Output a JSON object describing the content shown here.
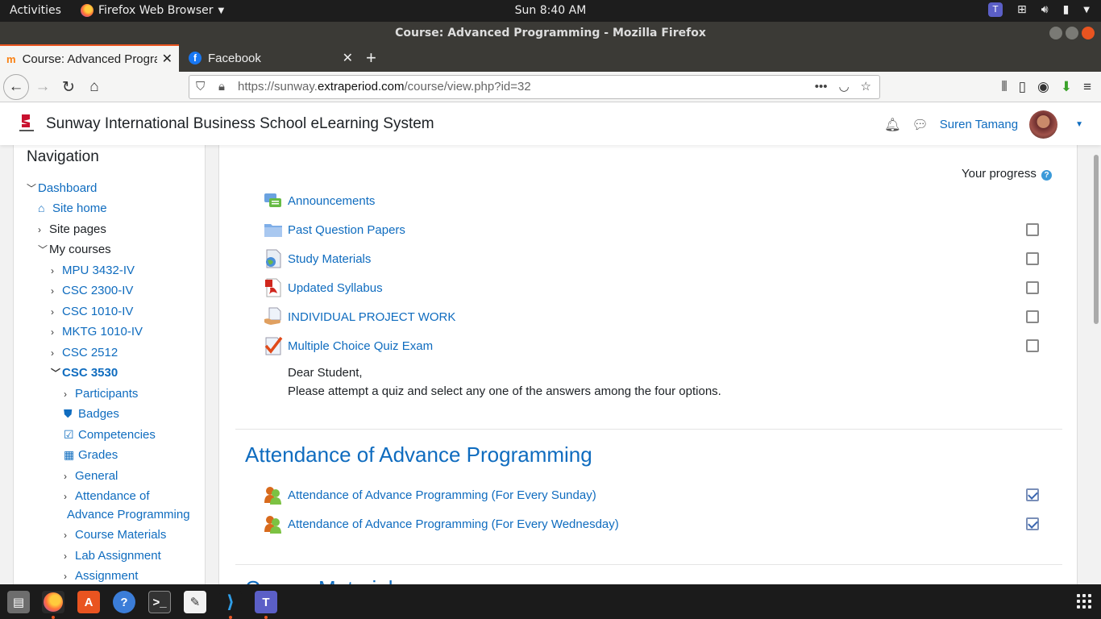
{
  "topbar": {
    "activities": "Activities",
    "app_name": "Firefox Web Browser",
    "clock": "Sun  8:40 AM"
  },
  "window": {
    "title": "Course: Advanced Programming - Mozilla Firefox"
  },
  "tabs": [
    {
      "label": "Course: Advanced Programming",
      "active": true
    },
    {
      "label": "Facebook",
      "active": false
    }
  ],
  "urlbar": {
    "prefix": "https://sunway.",
    "domain": "extraperiod.com",
    "path": "/course/view.php?id=32"
  },
  "header": {
    "site_name": "Sunway International Business School eLearning System",
    "user_name": "Suren Tamang"
  },
  "navigation": {
    "title": "Navigation",
    "items": [
      {
        "label": "Dashboard"
      },
      {
        "label": "Site home"
      },
      {
        "label": "Site pages"
      },
      {
        "label": "My courses"
      },
      {
        "label": "MPU 3432-IV"
      },
      {
        "label": "CSC 2300-IV"
      },
      {
        "label": "CSC 1010-IV"
      },
      {
        "label": "MKTG 1010-IV"
      },
      {
        "label": "CSC 2512"
      },
      {
        "label": "CSC 3530"
      },
      {
        "label": "Participants"
      },
      {
        "label": "Badges"
      },
      {
        "label": "Competencies"
      },
      {
        "label": "Grades"
      },
      {
        "label": "General"
      },
      {
        "label": "Attendance of"
      },
      {
        "label": "Advance Programming"
      },
      {
        "label": "Course Materials"
      },
      {
        "label": "Lab Assignment"
      },
      {
        "label": "Assignment"
      }
    ]
  },
  "content": {
    "progress_label": "Your progress",
    "activities": [
      {
        "label": "Announcements",
        "icon": "forum-icon",
        "checkbox": null
      },
      {
        "label": "Past Question Papers",
        "icon": "folder-icon",
        "checkbox": "unchecked"
      },
      {
        "label": "Study Materials",
        "icon": "url-icon",
        "checkbox": "unchecked"
      },
      {
        "label": "Updated Syllabus",
        "icon": "pdf-icon",
        "checkbox": "unchecked"
      },
      {
        "label": "INDIVIDUAL PROJECT WORK",
        "icon": "assignment-icon",
        "checkbox": "unchecked"
      },
      {
        "label": "Multiple Choice Quiz Exam",
        "icon": "quiz-icon",
        "checkbox": "unchecked"
      }
    ],
    "quiz_description": {
      "line1": "Dear Student,",
      "line2": "Please attempt a quiz and select any one of the answers among the four options."
    },
    "section_title": "Attendance of Advance Programming",
    "attendance": [
      {
        "label": "Attendance of Advance Programming (For Every Sunday)",
        "checkbox": "checked"
      },
      {
        "label": "Attendance of Advance Programming (For Every Wednesday)",
        "checkbox": "checked"
      }
    ],
    "next_section_partial": "Course Materials"
  },
  "colors": {
    "link": "#0f6cbf",
    "ubuntu_orange": "#e95420",
    "topbar": "#1d1d1d"
  }
}
